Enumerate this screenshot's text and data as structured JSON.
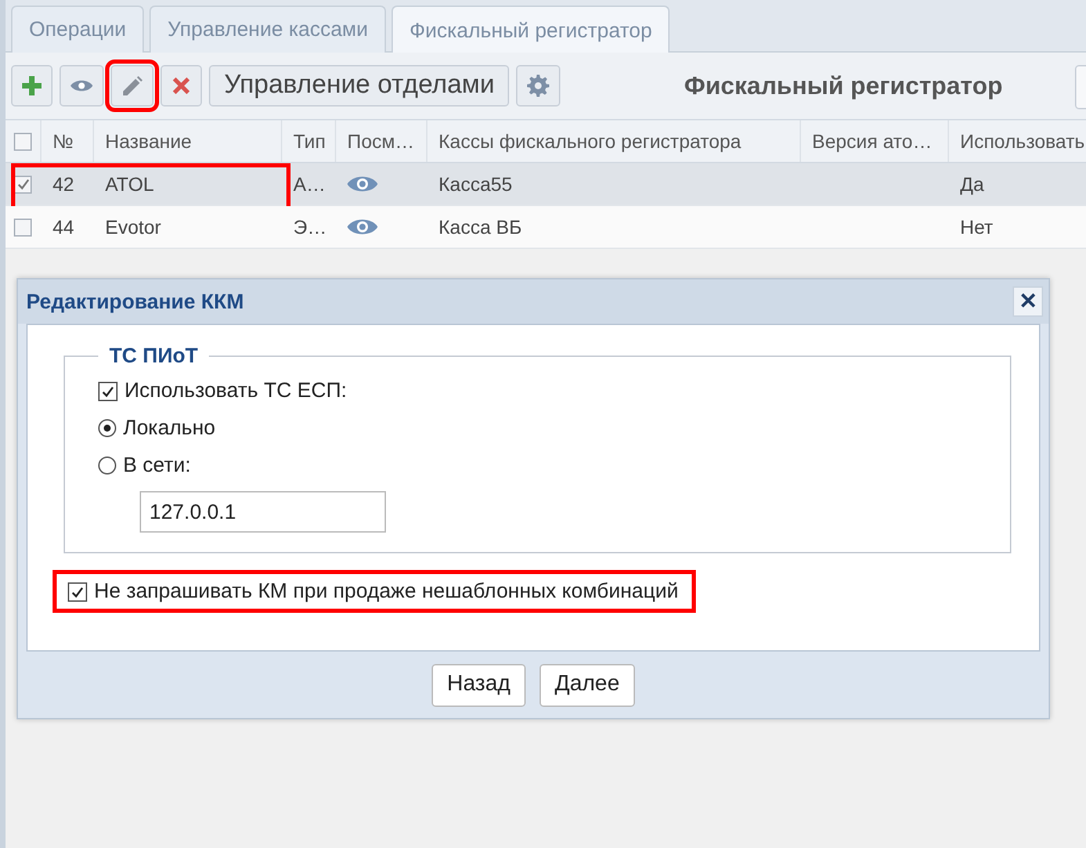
{
  "tabs": [
    {
      "label": "Операции",
      "selected": false
    },
    {
      "label": "Управление кассами",
      "selected": false
    },
    {
      "label": "Фискальный регистратор",
      "selected": true
    }
  ],
  "toolbar": {
    "buttons": [
      {
        "kind": "add",
        "highlighted": false
      },
      {
        "kind": "view",
        "highlighted": false
      },
      {
        "kind": "edit",
        "highlighted": true
      },
      {
        "kind": "delete",
        "highlighted": false
      },
      {
        "kind": "text",
        "label": "Управление отделами",
        "highlighted": false
      },
      {
        "kind": "settings",
        "highlighted": false
      }
    ],
    "title": "Фискальный регистратор"
  },
  "table": {
    "all_checked": false,
    "columns": [
      "№",
      "Название",
      "Тип",
      "Посм…",
      "Кассы фискального регистратора",
      "Версия ато…",
      "Использовать"
    ],
    "rows": [
      {
        "checked": true,
        "selected": true,
        "highlighted": true,
        "number": "42",
        "name": "ATOL",
        "type": "A…",
        "registers": "Касса55",
        "used": "Да"
      },
      {
        "checked": false,
        "selected": false,
        "highlighted": false,
        "number": "44",
        "name": "Evotor",
        "type": "Э…",
        "registers": "Касса ВБ",
        "used": "Нет"
      }
    ]
  },
  "dialog": {
    "title": "Редактирование ККМ",
    "close": "✕",
    "group": {
      "legend": "ТС ПИоТ",
      "options": [
        {
          "kind": "checkbox",
          "label": "Использовать ТС ЕСП:",
          "checked": true
        },
        {
          "kind": "radio",
          "label": "Локально",
          "checked": true
        },
        {
          "kind": "radio",
          "label": "В сети:",
          "checked": false
        }
      ],
      "address": "127.0.0.1"
    },
    "extra": {
      "label": "Не запрашивать КМ при продаже нешаблонных комбинаций",
      "checked": true,
      "highlighted": true
    },
    "buttons": [
      "Назад",
      "Далее"
    ]
  }
}
